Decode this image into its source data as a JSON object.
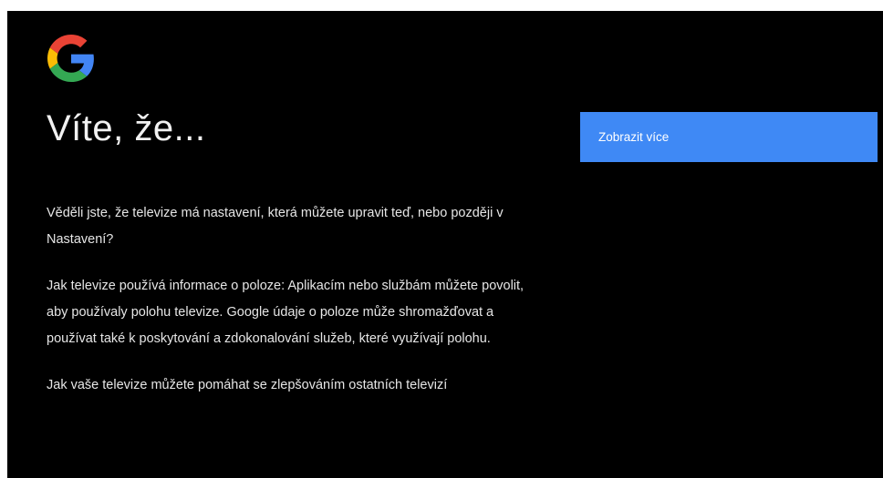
{
  "logo": {
    "icon": "google-g-logo",
    "colors": {
      "blue": "#4285F4",
      "red": "#EA4335",
      "yellow": "#FBBC05",
      "green": "#34A853"
    }
  },
  "title": "Víte, že...",
  "paragraphs": [
    "Věděli jste, že televize má nastavení, která můžete upravit teď, nebo později v Nastavení?",
    "Jak televize používá informace o poloze: Aplikacím nebo službám můžete povolit, aby používaly polohu televize. Google údaje o poloze může shromažďovat a používat také k poskytování a zdokonalování služeb, které využívají polohu.",
    "Jak vaše televize můžete pomáhat se zlepšováním ostatních televizí"
  ],
  "button": {
    "label": "Zobrazit více",
    "color": "#3F89F5"
  },
  "colors": {
    "background": "#000000",
    "text": "#FFFFFF"
  }
}
